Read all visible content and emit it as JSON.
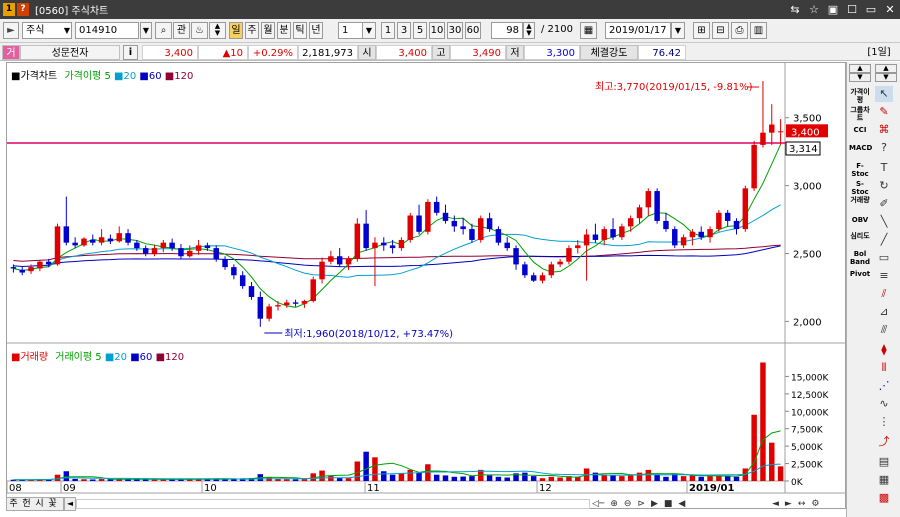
{
  "window": {
    "number_badge": "1",
    "help_badge": "?",
    "title": "[0560] 주식차트",
    "buttons": [
      "⇆",
      "☆",
      "▣",
      "☐",
      "▭",
      "✕"
    ]
  },
  "toolbar": {
    "arrow_icon": "play-arrow-icon",
    "market": "주식",
    "code": "014910",
    "search_label": "관",
    "period_buttons": [
      "일",
      "주",
      "월",
      "분",
      "틱",
      "년"
    ],
    "multiplier": "1",
    "tick_buttons": [
      "1",
      "3",
      "5",
      "10",
      "30",
      "60"
    ],
    "count": "98",
    "total": "/ 2100",
    "date": "2019/01/17"
  },
  "quote": {
    "tag": "거",
    "name": "성문전자",
    "info": "i",
    "price": "3,400",
    "change": "▲10",
    "change_pct": "+0.29%",
    "volume": "2,181,973",
    "open_label": "시",
    "open": "3,400",
    "high_label": "고",
    "high": "3,490",
    "low_label": "저",
    "low": "3,300",
    "strength_label": "체결강도",
    "strength": "76.42",
    "period_tag": "[1일]"
  },
  "price_panel": {
    "legend": {
      "title": "가격차트",
      "ma_label": "가격이평",
      "ma": [
        "5",
        "20",
        "60",
        "120"
      ]
    },
    "annotation_high": "최고:3,770(2019/01/15, -9.81%)",
    "annotation_low": "최저:1,960(2018/10/12, +73.47%)",
    "current_price_label": "3,400",
    "line_label": "3,314",
    "y_ticks": [
      "3,500",
      "3,000",
      "2,500",
      "2,000"
    ]
  },
  "volume_panel": {
    "legend": {
      "title": "거래량",
      "ma_label": "거래이평",
      "ma": [
        "5",
        "20",
        "60",
        "120"
      ]
    },
    "y_ticks": [
      "15,000K",
      "12,500K",
      "10,000K",
      "7,500K",
      "5,000K",
      "2,500K",
      "0K"
    ]
  },
  "x_axis": [
    "08",
    "09",
    "10",
    "11",
    "12",
    "2019/01"
  ],
  "bottom": {
    "tabs": [
      "주",
      "헌",
      "시",
      "꽃"
    ]
  },
  "right_toolbar": {
    "items": [
      "가격이평",
      "그룹차트",
      "CCI",
      "MACD",
      "F-Stoc",
      "S-Stoc",
      "거래량",
      "OBV",
      "심리도",
      "Bol Band",
      "Pivot"
    ]
  },
  "chart_data": {
    "type": "candlestick",
    "title": "가격차트",
    "ylim": [
      1900,
      3800
    ],
    "x_categories": [
      "08",
      "09",
      "10",
      "11",
      "12",
      "2019/01"
    ],
    "high": 3770,
    "high_date": "2019/01/15",
    "low": 1960,
    "low_date": "2018/10/12",
    "current": 3400,
    "line_value": 3314,
    "candles": [
      [
        2400,
        2420,
        2360,
        2390
      ],
      [
        2380,
        2400,
        2340,
        2360
      ],
      [
        2370,
        2420,
        2350,
        2400
      ],
      [
        2390,
        2450,
        2370,
        2440
      ],
      [
        2440,
        2460,
        2400,
        2420
      ],
      [
        2420,
        2720,
        2410,
        2700
      ],
      [
        2700,
        2920,
        2560,
        2580
      ],
      [
        2580,
        2620,
        2540,
        2560
      ],
      [
        2560,
        2620,
        2550,
        2610
      ],
      [
        2600,
        2640,
        2560,
        2580
      ],
      [
        2580,
        2680,
        2560,
        2620
      ],
      [
        2610,
        2640,
        2570,
        2590
      ],
      [
        2590,
        2700,
        2580,
        2650
      ],
      [
        2650,
        2680,
        2560,
        2580
      ],
      [
        2580,
        2600,
        2520,
        2540
      ],
      [
        2540,
        2560,
        2480,
        2500
      ],
      [
        2500,
        2560,
        2480,
        2540
      ],
      [
        2540,
        2600,
        2510,
        2580
      ],
      [
        2580,
        2610,
        2520,
        2540
      ],
      [
        2540,
        2570,
        2460,
        2480
      ],
      [
        2480,
        2560,
        2470,
        2520
      ],
      [
        2520,
        2600,
        2490,
        2560
      ],
      [
        2560,
        2580,
        2520,
        2540
      ],
      [
        2540,
        2560,
        2440,
        2460
      ],
      [
        2460,
        2480,
        2380,
        2400
      ],
      [
        2400,
        2420,
        2310,
        2340
      ],
      [
        2340,
        2370,
        2240,
        2260
      ],
      [
        2260,
        2290,
        2160,
        2180
      ],
      [
        2180,
        2220,
        1960,
        2020
      ],
      [
        2020,
        2130,
        2000,
        2110
      ],
      [
        2110,
        2150,
        2080,
        2120
      ],
      [
        2120,
        2160,
        2100,
        2140
      ],
      [
        2140,
        2160,
        2110,
        2130
      ],
      [
        2130,
        2160,
        2100,
        2150
      ],
      [
        2150,
        2330,
        2140,
        2310
      ],
      [
        2310,
        2470,
        2280,
        2440
      ],
      [
        2440,
        2520,
        2420,
        2480
      ],
      [
        2480,
        2540,
        2400,
        2420
      ],
      [
        2420,
        2480,
        2380,
        2460
      ],
      [
        2460,
        2760,
        2440,
        2720
      ],
      [
        2720,
        2820,
        2520,
        2540
      ],
      [
        2540,
        2620,
        2260,
        2580
      ],
      [
        2580,
        2620,
        2520,
        2560
      ],
      [
        2560,
        2600,
        2500,
        2540
      ],
      [
        2540,
        2620,
        2520,
        2600
      ],
      [
        2600,
        2800,
        2580,
        2780
      ],
      [
        2780,
        2860,
        2640,
        2660
      ],
      [
        2660,
        2900,
        2640,
        2880
      ],
      [
        2880,
        2920,
        2780,
        2800
      ],
      [
        2800,
        2860,
        2720,
        2740
      ],
      [
        2740,
        2780,
        2660,
        2700
      ],
      [
        2700,
        2760,
        2640,
        2680
      ],
      [
        2680,
        2720,
        2580,
        2600
      ],
      [
        2600,
        2780,
        2580,
        2760
      ],
      [
        2760,
        2800,
        2660,
        2680
      ],
      [
        2680,
        2700,
        2560,
        2580
      ],
      [
        2580,
        2620,
        2520,
        2540
      ],
      [
        2540,
        2560,
        2380,
        2420
      ],
      [
        2420,
        2440,
        2320,
        2340
      ],
      [
        2340,
        2360,
        2290,
        2300
      ],
      [
        2300,
        2360,
        2280,
        2340
      ],
      [
        2340,
        2440,
        2320,
        2420
      ],
      [
        2420,
        2460,
        2400,
        2440
      ],
      [
        2440,
        2560,
        2420,
        2540
      ],
      [
        2540,
        2600,
        2500,
        2560
      ],
      [
        2560,
        2680,
        2300,
        2640
      ],
      [
        2640,
        2720,
        2580,
        2600
      ],
      [
        2600,
        2700,
        2560,
        2680
      ],
      [
        2680,
        2760,
        2600,
        2620
      ],
      [
        2620,
        2720,
        2600,
        2700
      ],
      [
        2700,
        2780,
        2660,
        2760
      ],
      [
        2760,
        2860,
        2720,
        2840
      ],
      [
        2840,
        2980,
        2780,
        2960
      ],
      [
        2960,
        2980,
        2720,
        2740
      ],
      [
        2740,
        2800,
        2660,
        2680
      ],
      [
        2680,
        2700,
        2540,
        2560
      ],
      [
        2560,
        2640,
        2540,
        2620
      ],
      [
        2620,
        2680,
        2560,
        2660
      ],
      [
        2660,
        2700,
        2600,
        2620
      ],
      [
        2620,
        2700,
        2580,
        2680
      ],
      [
        2680,
        2820,
        2660,
        2800
      ],
      [
        2800,
        2820,
        2700,
        2740
      ],
      [
        2740,
        2760,
        2640,
        2680
      ],
      [
        2680,
        3000,
        2660,
        2980
      ],
      [
        2980,
        3330,
        2960,
        3300
      ],
      [
        3300,
        3770,
        3280,
        3390
      ],
      [
        3390,
        3600,
        3300,
        3450
      ],
      [
        3400,
        3490,
        3300,
        3400
      ]
    ],
    "ma_colors": {
      "5": "#00a000",
      "20": "#00a0d0",
      "60": "#0000c0",
      "120": "#900030"
    },
    "volume": [
      180,
      150,
      200,
      250,
      200,
      900,
      1400,
      300,
      250,
      220,
      280,
      220,
      320,
      280,
      240,
      220,
      200,
      240,
      220,
      260,
      220,
      280,
      240,
      260,
      300,
      350,
      380,
      420,
      980,
      520,
      280,
      260,
      240,
      260,
      1100,
      1500,
      800,
      420,
      400,
      2800,
      4200,
      3400,
      1400,
      900,
      1100,
      1600,
      1200,
      2400,
      900,
      800,
      600,
      640,
      700,
      1600,
      800,
      600,
      500,
      1100,
      1200,
      700,
      400,
      600,
      500,
      700,
      600,
      1800,
      1200,
      900,
      800,
      700,
      900,
      1200,
      1600,
      900,
      600,
      1000,
      700,
      800,
      600,
      700,
      800,
      700,
      600,
      1800,
      9500,
      17000,
      5500,
      2100
    ],
    "volume_ylim": [
      0,
      17500
    ]
  }
}
